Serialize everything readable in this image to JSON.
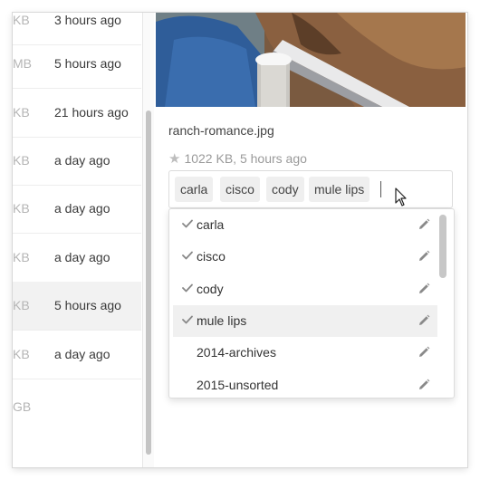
{
  "file_list": {
    "rows": [
      {
        "size": "KB",
        "time": "3 hours ago"
      },
      {
        "size": "MB",
        "time": "5 hours ago"
      },
      {
        "size": "KB",
        "time": "21 hours ago"
      },
      {
        "size": "KB",
        "time": "a day ago"
      },
      {
        "size": "KB",
        "time": "a day ago"
      },
      {
        "size": "KB",
        "time": "a day ago"
      },
      {
        "size": "KB",
        "time": "5 hours ago"
      },
      {
        "size": "KB",
        "time": "a day ago"
      },
      {
        "size": "GB",
        "time": ""
      }
    ]
  },
  "details": {
    "filename": "ranch-romance.jpg",
    "meta": "1022 KB, 5 hours ago",
    "star_icon": "star-icon"
  },
  "tags": {
    "chips": [
      "carla",
      "cisco",
      "cody",
      "mule lips"
    ]
  },
  "dropdown": {
    "items": [
      {
        "label": "carla",
        "checked": true
      },
      {
        "label": "cisco",
        "checked": true
      },
      {
        "label": "cody",
        "checked": true
      },
      {
        "label": "mule lips",
        "checked": true
      },
      {
        "label": "2014-archives",
        "checked": false
      },
      {
        "label": "2015-unsorted",
        "checked": false
      }
    ],
    "check_icon": "check-icon",
    "edit_icon": "pencil-icon"
  },
  "colors": {
    "accent_check": "#888888",
    "selected_row": "#f2f2f2",
    "chip_bg": "#efefef"
  }
}
